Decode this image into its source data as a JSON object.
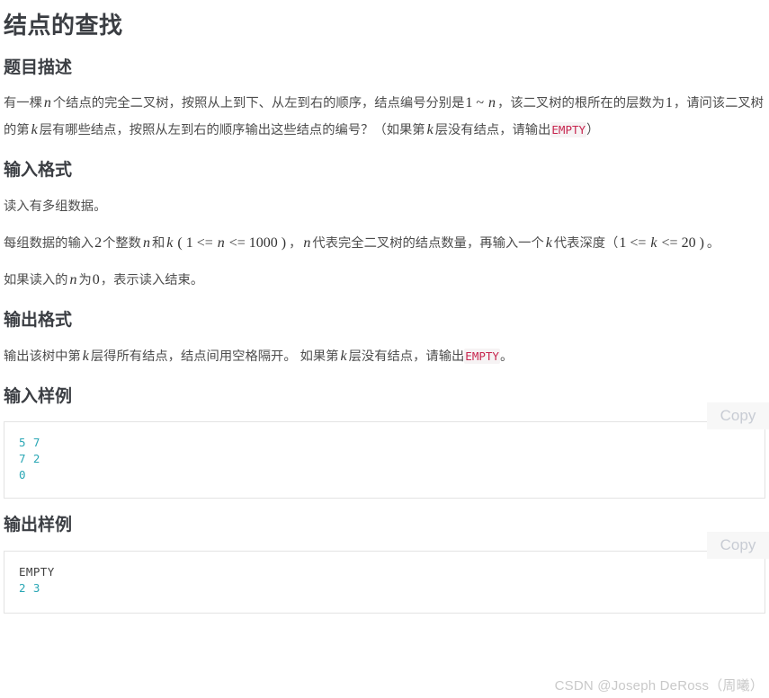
{
  "page": {
    "title": "结点的查找",
    "watermark": "CSDN @Joseph DeRoss（周曦）"
  },
  "sections": {
    "description": {
      "heading": "题目描述",
      "p1_a": "有一棵",
      "p1_n": "n",
      "p1_b": "个结点的完全二叉树，按照从上到下、从左到右的顺序，结点编号分别是",
      "p1_range_1": "1",
      "p1_range_tilde": "~",
      "p1_range_n": "n",
      "p1_c": "，该二叉树的根所在的层数为",
      "p1_one": "1",
      "p1_d": "，请问该二叉树的第",
      "p1_k": "k",
      "p1_e": "层有哪些结点，按照从左到右的顺序输出这些结点的编号？（如果第",
      "p1_k2": "k",
      "p1_f": "层没有结点，请输出",
      "p1_empty": "EMPTY",
      "p1_g": "）"
    },
    "input_format": {
      "heading": "输入格式",
      "p1": "读入有多组数据。",
      "p2_a": "每组数据的输入",
      "p2_two": "2",
      "p2_b": "个整数",
      "p2_n": "n",
      "p2_c": "和",
      "p2_k": "k",
      "p2_lparen": "(",
      "p2_one": "1",
      "p2_le1": "<=",
      "p2_n2": "n",
      "p2_le2": "<=",
      "p2_1000": "1000",
      "p2_rparen": ")",
      "p2_comma": "，",
      "p2_n3": "n",
      "p2_d": "代表完全二叉树的结点数量，再输入一个",
      "p2_k2": "k",
      "p2_e": "代表深度（",
      "p2_one2": "1",
      "p2_le3": "<=",
      "p2_k3": "k",
      "p2_le4": "<=",
      "p2_20": "20",
      "p2_rparen2": ")",
      "p2_f": "。",
      "p3_a": "如果读入的",
      "p3_n": "n",
      "p3_b": "为",
      "p3_zero": "0",
      "p3_c": "，表示读入结束。"
    },
    "output_format": {
      "heading": "输出格式",
      "p1_a": "输出该树中第",
      "p1_k": "k",
      "p1_b": "层得所有结点，结点间用空格隔开。 如果第",
      "p1_k2": "k",
      "p1_c": "层没有结点，请输出",
      "p1_empty": "EMPTY",
      "p1_d": "。"
    },
    "input_sample": {
      "heading": "输入样例",
      "copy_label": "Copy",
      "lines": [
        {
          "text": "5 7",
          "style": "num"
        },
        {
          "text": "7 2",
          "style": "num"
        },
        {
          "text": "0",
          "style": "num"
        }
      ]
    },
    "output_sample": {
      "heading": "输出样例",
      "copy_label": "Copy",
      "lines": [
        {
          "text": "EMPTY",
          "style": "plain"
        },
        {
          "text": "2 3",
          "style": "num"
        }
      ]
    }
  },
  "colors": {
    "heading": "#3b3e43",
    "body": "#4d4d4d",
    "inline_code": "#c7254e",
    "code_number": "#2aa7b5",
    "code_plain": "#3f3f3f",
    "copy_text": "#c8ccd4",
    "watermark": "#c9c9c9",
    "box_border": "#e3e3e3"
  }
}
